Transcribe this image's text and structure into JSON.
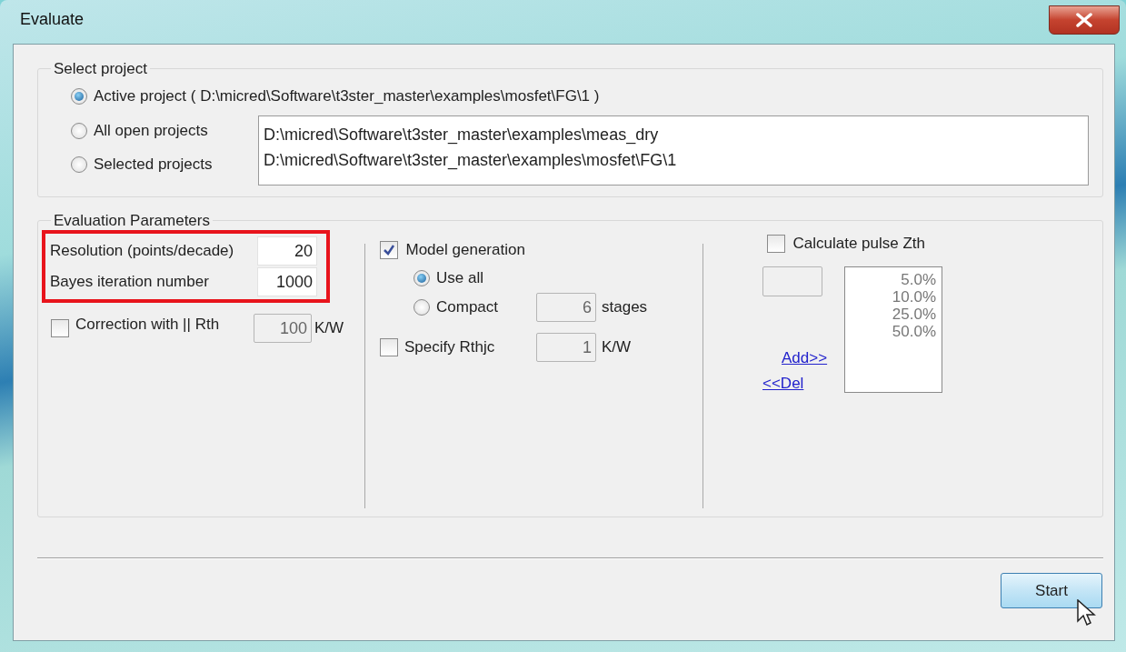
{
  "window": {
    "title": "Evaluate"
  },
  "select_project": {
    "legend": "Select project",
    "options": [
      {
        "label": "Active project ( D:\\micred\\Software\\t3ster_master\\examples\\mosfet\\FG\\1 )",
        "selected": true
      },
      {
        "label": "All open projects",
        "selected": false
      },
      {
        "label": "Selected projects",
        "selected": false
      }
    ],
    "project_list": [
      "D:\\micred\\Software\\t3ster_master\\examples\\meas_dry",
      "D:\\micred\\Software\\t3ster_master\\examples\\mosfet\\FG\\1"
    ]
  },
  "evaluation_parameters": {
    "legend": "Evaluation Parameters",
    "highlighted": true,
    "fields": [
      {
        "label": "Resolution (points/decade)",
        "value": "20"
      },
      {
        "label": "Bayes iteration number",
        "value": "1000"
      }
    ],
    "correction": {
      "label": "Correction with || Rth",
      "checked": false,
      "value": "100",
      "unit": "K/W"
    },
    "model_generation": {
      "label": "Model generation",
      "checked": true,
      "options": [
        {
          "label": "Use all",
          "selected": true
        },
        {
          "label": "Compact",
          "selected": false
        }
      ],
      "stages_value": "6",
      "stages_unit": "stages"
    },
    "rthjc": {
      "label": "Specify Rthjc",
      "checked": false,
      "value": "1",
      "unit": "K/W"
    },
    "pulse": {
      "label": "Calculate pulse Zth",
      "checked": false,
      "add_link": "Add>>",
      "del_link": "<<Del",
      "duty_list": [
        "5.0%",
        "10.0%",
        "25.0%",
        "50.0%"
      ]
    }
  },
  "start_button": "Start"
}
